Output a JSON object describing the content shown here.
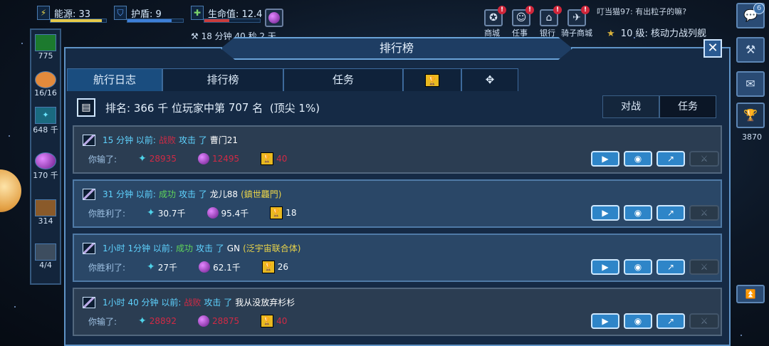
{
  "hud": {
    "energy_label": "能源: 33",
    "shield_label": "护盾: 9",
    "health_label": "生命值: 12.4",
    "timer_label": "18 分钟 40 秒 2 天",
    "chat_text": "叮当猫97: 有出粒子的嘛?",
    "level_text": "10 级: 核动力战列舰",
    "toolbar": [
      {
        "label": "商城",
        "icon": "star-badge-icon",
        "badge": "!"
      },
      {
        "label": "任事",
        "icon": "smiley-icon",
        "badge": "!"
      },
      {
        "label": "银行",
        "icon": "bank-icon",
        "badge": "!"
      },
      {
        "label": "骑子商城",
        "icon": "plane-icon",
        "badge": "!"
      }
    ]
  },
  "left_sidebar": {
    "items": [
      {
        "icon": "cash-icon",
        "value": "775"
      },
      {
        "icon": "crew-icon",
        "value": "16/16"
      },
      {
        "icon": "crystal-icon",
        "value": "648 千"
      },
      {
        "icon": "gas-orb-icon",
        "value": "170 千"
      },
      {
        "icon": "crate-icon",
        "value": "314"
      },
      {
        "icon": "tank-icon",
        "value": "4/4"
      }
    ]
  },
  "right_sidebar": {
    "chat_badge": "6",
    "trophy_value": "3870"
  },
  "panel": {
    "title": "排行榜",
    "tabs": [
      {
        "label": "航行日志",
        "active": true
      },
      {
        "label": "排行榜",
        "active": false
      },
      {
        "label": "任务",
        "active": false
      },
      {
        "label": "",
        "icon": "trophy-icon",
        "active": false
      },
      {
        "label": "",
        "icon": "targets-icon",
        "active": false
      }
    ],
    "rank_prefix": "排名:",
    "rank_total": "366 千",
    "rank_mid": "位玩家中第",
    "rank_pos": "707",
    "rank_suffix": "名",
    "rank_top": "(顶尖 1%)",
    "filters": [
      "对战",
      "任务"
    ]
  },
  "entries": [
    {
      "time": "15 分钟 以前:",
      "result": "战败",
      "verb": "攻击 了",
      "opponent": "曹门21",
      "alliance": "",
      "outcome_label": "你输了:",
      "crystal": "28935",
      "gas": "12495",
      "trophy": "40",
      "win": false
    },
    {
      "time": "31 分钟 以前:",
      "result": "成功",
      "verb": "攻击 了",
      "opponent": "龙儿88",
      "alliance": "(鎮世龘門)",
      "outcome_label": "你胜利了:",
      "crystal": "30.7千",
      "gas": "95.4千",
      "trophy": "18",
      "win": true
    },
    {
      "time": "1小时 1分钟 以前:",
      "result": "成功",
      "verb": "攻击 了",
      "opponent": "GN",
      "alliance": "(泛宇宙联合体)",
      "outcome_label": "你胜利了:",
      "crystal": "27千",
      "gas": "62.1千",
      "trophy": "26",
      "win": true
    },
    {
      "time": "1小时 40 分钟 以前:",
      "result": "战败",
      "verb": "攻击 了",
      "opponent": "我从没放弃杉杉",
      "alliance": "",
      "outcome_label": "你输了:",
      "crystal": "28892",
      "gas": "28875",
      "trophy": "40",
      "win": false
    }
  ]
}
